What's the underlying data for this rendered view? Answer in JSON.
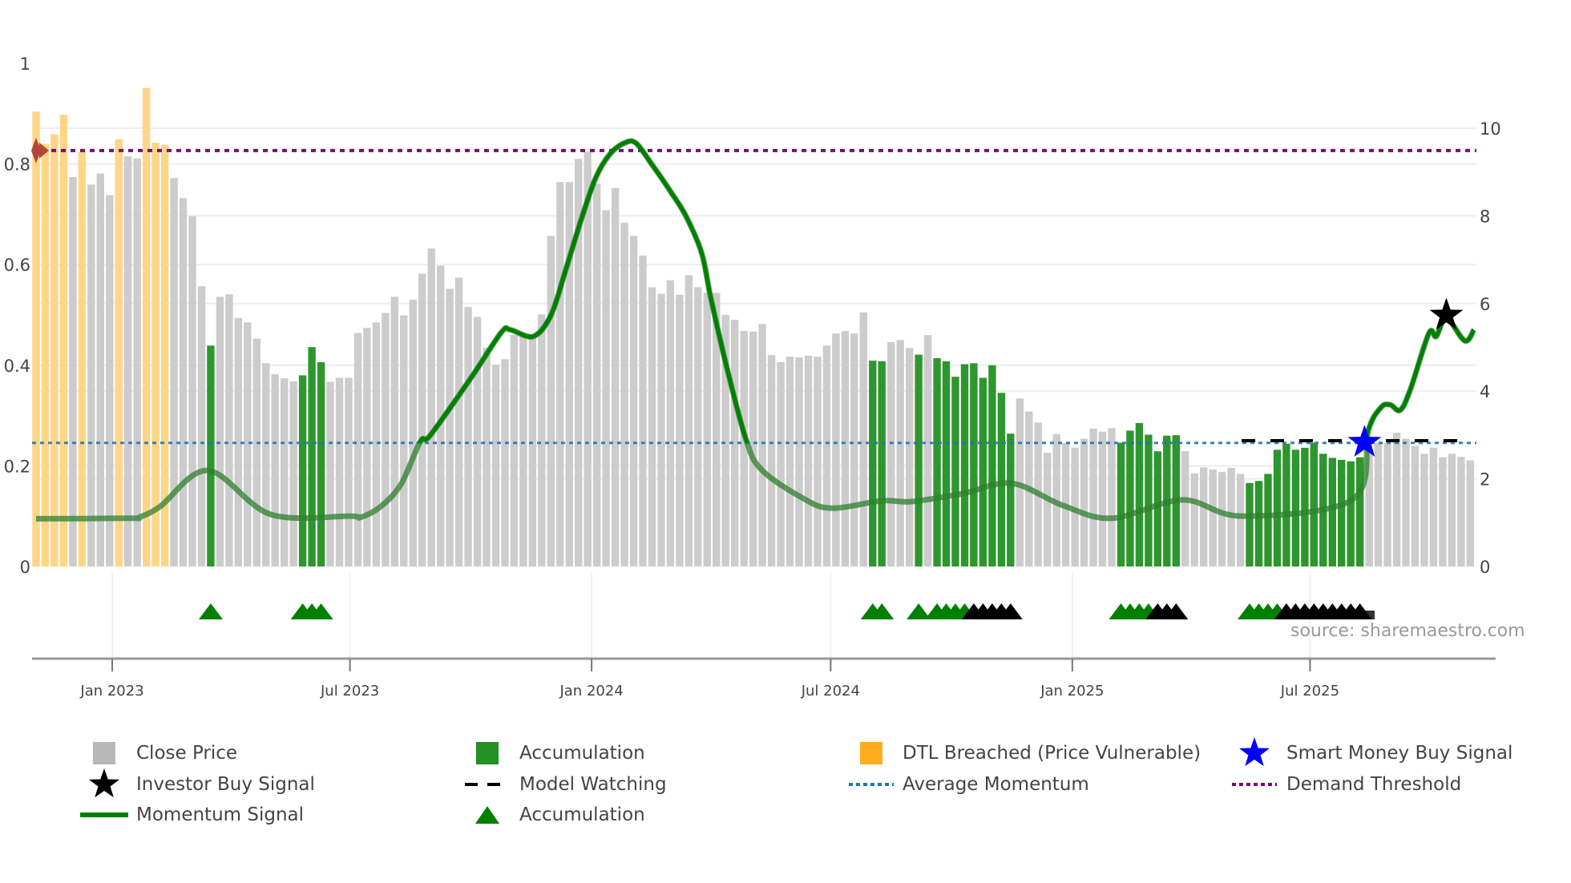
{
  "colors": {
    "close": "#cccccc",
    "close_legend": "#b8b8b8",
    "accumulation": "#2e962e",
    "dtl": "#ffd587",
    "dtl_legend": "#ffad1f",
    "momentum": "#008000",
    "average": "#1f77b4",
    "demand": "#7a0a7a",
    "watching": "#000000",
    "smart_money": "#0000ff",
    "investor": "#000000",
    "dtl_marker": "#b5443a"
  },
  "source": "source: sharemaestro.com",
  "legend": [
    {
      "label": "Close Price",
      "icon": "gray-square"
    },
    {
      "label": "Accumulation",
      "icon": "green-square"
    },
    {
      "label": "DTL Breached (Price Vulnerable)",
      "icon": "orange-square"
    },
    {
      "label": "Smart Money Buy Signal",
      "icon": "blue-star"
    },
    {
      "label": "Investor Buy Signal",
      "icon": "black-star"
    },
    {
      "label": "Model Watching",
      "icon": "black-dashed-line"
    },
    {
      "label": "Average Momentum",
      "icon": "blue-dotted-line"
    },
    {
      "label": "Demand Threshold",
      "icon": "purple-dotted-line"
    },
    {
      "label": "Momentum Signal",
      "icon": "green-line"
    },
    {
      "label": "Accumulation",
      "icon": "green-triangle"
    }
  ],
  "chart_data": {
    "type": "bar",
    "start_date": "2022-11-04",
    "interval_days": 7,
    "left_axis": {
      "range": [
        0,
        1
      ],
      "ticks": [
        "0",
        "0.2",
        "0.4",
        "0.6",
        "0.8",
        "1"
      ],
      "tick_values": [
        0,
        0.2,
        0.4,
        0.6,
        0.8,
        1
      ]
    },
    "right_axis": {
      "range": [
        0,
        10
      ],
      "ticks": [
        "0",
        "2",
        "4",
        "6",
        "8",
        "10"
      ],
      "tick_values": [
        0,
        2,
        4,
        6,
        8,
        10
      ]
    },
    "x_ticks": [
      {
        "label": "Jan 2023",
        "date": "2023-01-01"
      },
      {
        "label": "Jul 2023",
        "date": "2023-07-01"
      },
      {
        "label": "Jan 2024",
        "date": "2024-01-01"
      },
      {
        "label": "Jul 2024",
        "date": "2024-07-01"
      },
      {
        "label": "Jan 2025",
        "date": "2025-01-01"
      },
      {
        "label": "Jul 2025",
        "date": "2025-07-01"
      }
    ],
    "close_price": [
      0.904,
      0.84,
      0.859,
      0.898,
      0.774,
      0.825,
      0.759,
      0.781,
      0.738,
      0.849,
      0.815,
      0.811,
      0.951,
      0.842,
      0.838,
      0.772,
      0.732,
      0.696,
      0.557,
      0.439,
      0.536,
      0.541,
      0.494,
      0.485,
      0.453,
      0.404,
      0.382,
      0.374,
      0.368,
      0.38,
      0.436,
      0.406,
      0.367,
      0.375,
      0.375,
      0.464,
      0.474,
      0.485,
      0.504,
      0.536,
      0.499,
      0.53,
      0.582,
      0.632,
      0.598,
      0.552,
      0.574,
      0.516,
      0.496,
      0.435,
      0.401,
      0.412,
      0.46,
      0.463,
      0.457,
      0.501,
      0.657,
      0.764,
      0.764,
      0.81,
      0.824,
      0.761,
      0.708,
      0.752,
      0.683,
      0.657,
      0.618,
      0.555,
      0.542,
      0.569,
      0.54,
      0.579,
      0.555,
      0.544,
      0.544,
      0.5,
      0.49,
      0.468,
      0.467,
      0.482,
      0.42,
      0.406,
      0.417,
      0.416,
      0.419,
      0.417,
      0.439,
      0.463,
      0.468,
      0.463,
      0.505,
      0.409,
      0.408,
      0.446,
      0.45,
      0.434,
      0.421,
      0.46,
      0.414,
      0.408,
      0.377,
      0.402,
      0.404,
      0.375,
      0.4,
      0.345,
      0.264,
      0.334,
      0.308,
      0.286,
      0.226,
      0.263,
      0.245,
      0.236,
      0.254,
      0.274,
      0.268,
      0.275,
      0.246,
      0.27,
      0.285,
      0.262,
      0.229,
      0.26,
      0.261,
      0.229,
      0.185,
      0.197,
      0.193,
      0.188,
      0.196,
      0.184,
      0.166,
      0.17,
      0.184,
      0.232,
      0.244,
      0.232,
      0.236,
      0.246,
      0.224,
      0.216,
      0.212,
      0.209,
      0.217,
      0.232,
      0.245,
      0.245,
      0.266,
      0.254,
      0.24,
      0.224,
      0.236,
      0.217,
      0.224,
      0.218,
      0.211
    ],
    "dtl_breached_weeks": [
      0,
      1,
      2,
      3,
      5,
      9,
      12,
      13,
      14
    ],
    "accumulation_weeks": [
      19,
      29,
      30,
      31,
      91,
      92,
      96,
      98,
      99,
      100,
      101,
      102,
      103,
      104,
      105,
      106,
      118,
      119,
      120,
      121,
      122,
      123,
      124,
      132,
      133,
      134,
      135,
      136,
      137,
      138,
      139,
      140,
      141,
      142,
      143,
      144
    ],
    "momentum": [
      [
        0,
        1.09
      ],
      [
        10.2,
        1.1
      ],
      [
        11.3,
        1.13
      ],
      [
        13.5,
        1.37
      ],
      [
        18.7,
        2.19
      ],
      [
        25.5,
        1.19
      ],
      [
        34.2,
        1.15
      ],
      [
        35.3,
        1.12
      ],
      [
        37.5,
        1.37
      ],
      [
        39.7,
        1.88
      ],
      [
        41.8,
        2.85
      ],
      [
        42.9,
        3.0
      ],
      [
        47.3,
        4.3
      ],
      [
        50.6,
        5.34
      ],
      [
        51.6,
        5.4
      ],
      [
        54.1,
        5.25
      ],
      [
        56,
        5.73
      ],
      [
        57.6,
        6.76
      ],
      [
        59.3,
        7.92
      ],
      [
        60.9,
        8.88
      ],
      [
        62.5,
        9.43
      ],
      [
        64.2,
        9.68
      ],
      [
        65.3,
        9.65
      ],
      [
        66.9,
        9.2
      ],
      [
        69,
        8.56
      ],
      [
        70.7,
        7.99
      ],
      [
        72.4,
        7.15
      ],
      [
        73.4,
        6.12
      ],
      [
        75.1,
        4.57
      ],
      [
        77.2,
        2.91
      ],
      [
        78.9,
        2.21
      ],
      [
        83.3,
        1.57
      ],
      [
        86.5,
        1.33
      ],
      [
        92,
        1.5
      ],
      [
        95.2,
        1.48
      ],
      [
        100.7,
        1.66
      ],
      [
        106.1,
        1.9
      ],
      [
        111.6,
        1.4
      ],
      [
        117,
        1.1
      ],
      [
        124.7,
        1.52
      ],
      [
        131.2,
        1.15
      ],
      [
        143.2,
        1.53
      ],
      [
        144.9,
        3.1
      ],
      [
        146.3,
        3.63
      ],
      [
        147.3,
        3.69
      ],
      [
        148.4,
        3.57
      ],
      [
        149.5,
        4.05
      ],
      [
        151.5,
        5.32
      ],
      [
        152.3,
        5.25
      ],
      [
        153.4,
        5.67
      ],
      [
        155.4,
        5.15
      ],
      [
        156.4,
        5.4
      ]
    ],
    "average_momentum": 2.82,
    "demand_threshold": 9.49,
    "model_watching": {
      "from_week": 132,
      "to_week": 156,
      "value": 2.87
    },
    "smart_money_buy": {
      "week": 144.5,
      "value": 2.83
    },
    "investor_buy": {
      "week": 153.4,
      "value": 5.73
    },
    "dtl_marker_week": 0,
    "accumulation_triangles": [
      {
        "week": 19,
        "color": "green"
      },
      {
        "week": 29,
        "color": "green"
      },
      {
        "week": 30,
        "color": "green"
      },
      {
        "week": 31,
        "color": "green"
      },
      {
        "week": 91,
        "color": "green"
      },
      {
        "week": 92,
        "color": "green"
      },
      {
        "week": 96,
        "color": "green"
      },
      {
        "week": 98,
        "color": "green"
      },
      {
        "week": 99,
        "color": "green"
      },
      {
        "week": 100,
        "color": "green"
      },
      {
        "week": 101,
        "color": "green"
      },
      {
        "week": 102,
        "color": "black"
      },
      {
        "week": 103,
        "color": "black"
      },
      {
        "week": 104,
        "color": "black"
      },
      {
        "week": 105,
        "color": "black"
      },
      {
        "week": 106,
        "color": "black"
      },
      {
        "week": 118,
        "color": "green"
      },
      {
        "week": 119,
        "color": "green"
      },
      {
        "week": 120,
        "color": "green"
      },
      {
        "week": 121,
        "color": "green"
      },
      {
        "week": 122,
        "color": "black"
      },
      {
        "week": 123,
        "color": "black"
      },
      {
        "week": 124,
        "color": "black"
      },
      {
        "week": 132,
        "color": "green"
      },
      {
        "week": 133,
        "color": "green"
      },
      {
        "week": 134,
        "color": "green"
      },
      {
        "week": 135,
        "color": "green"
      },
      {
        "week": 136,
        "color": "black"
      },
      {
        "week": 137,
        "color": "black"
      },
      {
        "week": 138,
        "color": "black"
      },
      {
        "week": 139,
        "color": "black"
      },
      {
        "week": 140,
        "color": "black"
      },
      {
        "week": 141,
        "color": "black"
      },
      {
        "week": 142,
        "color": "black"
      },
      {
        "week": 143,
        "color": "black"
      },
      {
        "week": 144,
        "color": "black"
      }
    ],
    "legend_position": "bottom",
    "grid": true
  }
}
